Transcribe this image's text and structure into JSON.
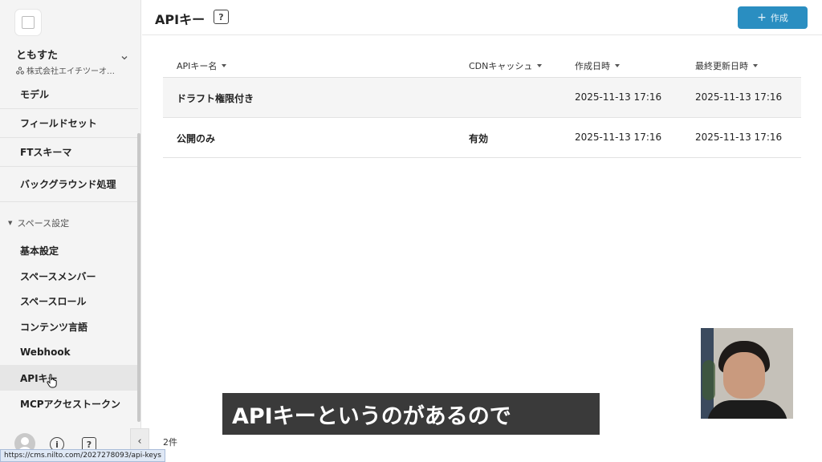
{
  "header": {
    "title": "APIキー",
    "help_icon": "help-icon",
    "create_label": "作成",
    "create_icon": "+"
  },
  "sidebar": {
    "space_name": "ともすた",
    "space_org": "株式会社エイチツーオ…",
    "items_top": [
      {
        "label": "モデル"
      },
      {
        "label": "フィールドセット"
      },
      {
        "label": "FTスキーマ"
      },
      {
        "label": "バックグラウンド処理"
      }
    ],
    "section_label": "スペース設定",
    "items_settings": [
      {
        "label": "基本設定"
      },
      {
        "label": "スペースメンバー"
      },
      {
        "label": "スペースロール"
      },
      {
        "label": "コンテンツ言語"
      },
      {
        "label": "Webhook"
      },
      {
        "label": "APIキー"
      },
      {
        "label": "MCPアクセストークン"
      }
    ],
    "info_icon": "i",
    "help_icon": "?",
    "collapse_icon": "‹"
  },
  "table": {
    "columns": [
      "APIキー名",
      "CDNキャッシュ",
      "作成日時",
      "最終更新日時"
    ],
    "rows": [
      {
        "name": "ドラフト権限付き",
        "cdn": "",
        "created": "2025-11-13 17:16",
        "updated": "2025-11-13 17:16"
      },
      {
        "name": "公開のみ",
        "cdn": "有効",
        "created": "2025-11-13 17:16",
        "updated": "2025-11-13 17:16"
      }
    ],
    "count": "2件"
  },
  "caption": "APIキーというのがあるので",
  "status_url": "https://cms.nilto.com/2027278093/api-keys",
  "colors": {
    "accent": "#2a8ec1",
    "sidebar_bg": "#f4f4f4",
    "caption_bg": "#3a3a3a"
  }
}
